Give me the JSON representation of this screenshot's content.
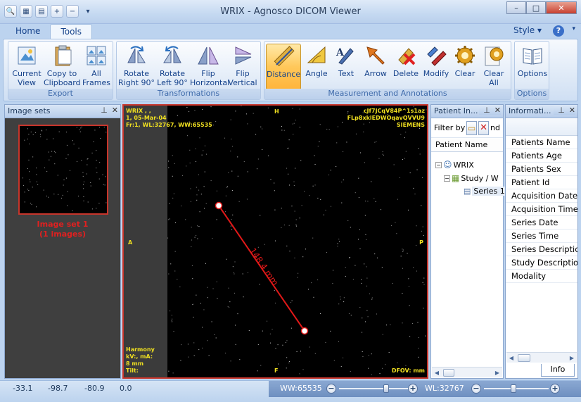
{
  "window": {
    "title": "WRIX - Agnosco DICOM Viewer",
    "controls": {
      "minimize": "–",
      "maximize": "□",
      "close": "✕"
    }
  },
  "ribbon_tabs": [
    {
      "label": "Home"
    },
    {
      "label": "Tools",
      "active": true
    }
  ],
  "style_menu": "Style",
  "help": "?",
  "ribbon_groups": {
    "export": {
      "label": "Export",
      "buttons": [
        {
          "label1": "Current",
          "label2": "View"
        },
        {
          "label1": "Copy to",
          "label2": "Clipboard"
        },
        {
          "label1": "All",
          "label2": "Frames"
        }
      ]
    },
    "transformations": {
      "label": "Transformations",
      "buttons": [
        {
          "label1": "Rotate",
          "label2": "Right 90°"
        },
        {
          "label1": "Rotate",
          "label2": "Left 90°"
        },
        {
          "label1": "Flip",
          "label2": "Horizontal"
        },
        {
          "label1": "Flip",
          "label2": "Vertical"
        }
      ]
    },
    "measurement": {
      "label": "Measurement and Annotations",
      "buttons": [
        {
          "label1": "Distance",
          "label2": ""
        },
        {
          "label1": "Angle",
          "label2": ""
        },
        {
          "label1": "Text",
          "label2": ""
        },
        {
          "label1": "Arrow",
          "label2": ""
        },
        {
          "label1": "Delete",
          "label2": ""
        },
        {
          "label1": "Modify",
          "label2": ""
        },
        {
          "label1": "Clear",
          "label2": ""
        },
        {
          "label1": "Clear",
          "label2": "All"
        }
      ]
    },
    "options": {
      "label": "Options",
      "buttons": [
        {
          "label1": "Options",
          "label2": ""
        }
      ]
    }
  },
  "image_sets": {
    "title": "Image sets",
    "item": {
      "caption1": "Image set 1",
      "caption2": "(1 images)"
    }
  },
  "viewer": {
    "overlay_top_left": [
      "WRIX , ,",
      "1, 05-Mar-04",
      "Fr:1, WL:32767, WW:65535"
    ],
    "overlay_top_right": [
      "cJf7JCqV84P^1s1az",
      "FLp8xklEDWOqavQVVU9",
      "SIEMENS"
    ],
    "overlay_bottom_left": [
      "Harmony",
      "kV:, mA:",
      "8 mm",
      "Tilt:"
    ],
    "overlay_bottom_right": "DFOV: mm",
    "orientation": {
      "top": "H",
      "bottom": "F",
      "left": "A",
      "right": "P"
    },
    "measurement": {
      "label": "148.4 mm"
    },
    "line_color": "#e01818"
  },
  "patient_info": {
    "title": "Patient In...",
    "filter_label": "Filter by",
    "filter_extra": "nd",
    "column_header": "Patient Name",
    "tree": {
      "patient": "WRIX",
      "study": "Study / W",
      "series": "Series 1"
    }
  },
  "information": {
    "title": "Informati...",
    "items": [
      "Patients Name",
      "Patients Age",
      "Patients Sex",
      "Patient Id",
      "Acquisition Date",
      "Acquisition Time",
      "Series Date",
      "Series Time",
      "Series Description",
      "Study Description",
      "Modality"
    ],
    "tab_label": "Info"
  },
  "status_bar": {
    "values": [
      "-33.1",
      "-98.7",
      "-80.9",
      "0.0"
    ],
    "ww": "WW:65535",
    "wl": "WL:32767",
    "ww_position": 0.7,
    "wl_position": 0.45
  }
}
